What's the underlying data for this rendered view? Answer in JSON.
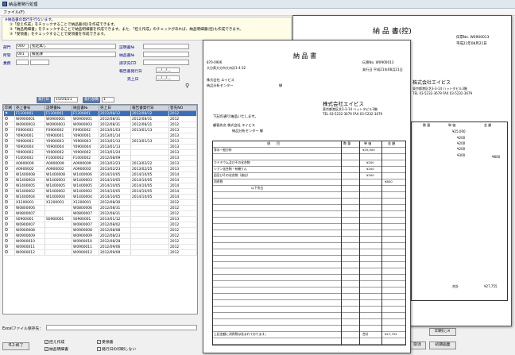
{
  "window": {
    "title": "納品書発行処理",
    "menu": "ファイル(F)"
  },
  "notice": {
    "line1": "※納品書の発行を行ないます。",
    "line2": "①「控え作成」をチェックすることで納品書(控)を作成できます。",
    "line3": "②「納品明細書」をチェックすることで納品明細書を作成できます。また、「控え作成」のチェックがあれば、納品明細書(控)も作成できます。",
    "line4": "③「受領書」をチェックすることで受領書を作成できます。"
  },
  "filters": {
    "bumon_label": "部門",
    "bumon_code": "000",
    "bumon_value": "指定無し",
    "shozoku_label": "所管",
    "shozoku_code": "001",
    "shozoku_value": "検査課",
    "gyosha_label": "業務",
    "seikyu_label": "証明書№",
    "nohin_label": "納品書№",
    "report_label": "報告書発行日",
    "uriage_label": "売上日",
    "client_label": "請求先CD",
    "date_blank": "__/__/__",
    "hakko_label": "発行日",
    "hakko_value": "15/04/21",
    "busu_label": "発行部数",
    "busu_value": "1"
  },
  "table": {
    "headers": [
      "印刷",
      "売上番号",
      "証明書№",
      "納品書№",
      "売上日",
      "報告書発行日",
      "客先NO"
    ],
    "rows": [
      [
        "F1200001",
        "F1200001",
        "F1200001",
        "2012/08/12",
        "2012/08/12",
        "2012"
      ],
      [
        "W0900001",
        "W0900001",
        "W0900001",
        "2012/08/31",
        "2012/08/31",
        "2012"
      ],
      [
        "W0900003",
        "W0900003",
        "W0900003",
        "2012/08/31",
        "2012/08/31",
        "2012"
      ],
      [
        "F0900002",
        "F0900002",
        "F0900002",
        "2013/01/03",
        "2013/01/13",
        "2013"
      ],
      [
        "Y0900001",
        "Y0900001",
        "Y0900001",
        "2013/01/14",
        "",
        "2013"
      ],
      [
        "Y0900003",
        "Y0900003",
        "Y0900003",
        "2013/01/13",
        "2013/01/13",
        "2013"
      ],
      [
        "Y0900004",
        "Y0900004",
        "Y0900004",
        "2013/01/13",
        "",
        "2013"
      ],
      [
        "Y0900002",
        "Y0900002",
        "Y0900002",
        "2013/01/24",
        "",
        "2013"
      ],
      [
        "F1000002",
        "F1000002",
        "F1000002",
        "2012/08/09",
        "",
        "2013"
      ],
      [
        "A0900009",
        "A0900009",
        "A0900009",
        "2013/02/23",
        "2013/02/22",
        "2013"
      ],
      [
        "A0900002",
        "A0900002",
        "A0900002",
        "2013/02/23",
        "2013/02/25",
        "2013"
      ],
      [
        "W1400008",
        "W1400008",
        "W1400006",
        "2014/10/05",
        "2014/10/05",
        "2014"
      ],
      [
        "W1400003",
        "W1400003",
        "W1400003",
        "2014/10/05",
        "2014/10/05",
        "2014"
      ],
      [
        "W1400005",
        "W1400005",
        "W1400005",
        "2014/10/05",
        "2014/10/05",
        "2014"
      ],
      [
        "W1400002",
        "W1400002",
        "W1400002",
        "2014/10/05",
        "2014/10/05",
        "2014"
      ],
      [
        "W1400004",
        "W1400004",
        "W1400004",
        "2014/10/05",
        "2014/10/05",
        "2014"
      ],
      [
        "X1200001",
        "X1200001",
        "X1200001",
        "2012/08/30",
        "",
        "2012"
      ],
      [
        "W0800006",
        "",
        "W0800006",
        "2012/08/31",
        "",
        "2012"
      ],
      [
        "W0800007",
        "",
        "W0800007",
        "2012/08/31",
        "",
        "2012"
      ],
      [
        "S0900001",
        "S0900001",
        "S0900001",
        "2013/01/12",
        "",
        "2013"
      ],
      [
        "W0900007",
        "",
        "W0900007",
        "2012/08/02",
        "",
        "2012"
      ],
      [
        "W0900008",
        "",
        "W0900008",
        "2012/08/08",
        "",
        "2012"
      ],
      [
        "W0900009",
        "",
        "W0900009",
        "2012/08/23",
        "",
        "2012"
      ],
      [
        "W0900010",
        "",
        "W0900010",
        "2012/08/28",
        "",
        "2012"
      ],
      [
        "W0900011",
        "",
        "W0900011",
        "2012/09/06",
        "",
        "2012"
      ],
      [
        "W0900012",
        "",
        "W0900012",
        "2012/09/09",
        "",
        "2012"
      ]
    ]
  },
  "bottom": {
    "excel_label": "Excelファイル保存先：",
    "f12": "f12:終了",
    "ck_hikae": "控え作成",
    "ck_juryo": "受領書",
    "ck_meisai": "納品明細書",
    "ck_noprint": "発行日の印刷しない",
    "btn_torikeshi": "取消",
    "btn_init": "初期画面",
    "btn_print": "印刷(○×"
  },
  "back_sheet": {
    "title": "納 品 書(控)",
    "denpyo": "伝票No.  W0900013",
    "hakko": "平成21年08月21日",
    "company": "株式会社エイビス",
    "addr": "東京都港区芝3-3-14 ハットタビル3階",
    "tel": "TEL 03-5232-3679  FAX 03-5232-3679",
    "h_qty": "数 量",
    "h_unit": "単 価",
    "h_amount": "金 額",
    "v1": "¥25,000",
    "v2": "¥200",
    "v3": "¥200",
    "v4": "¥200",
    "v5": "¥300",
    "v6": "¥800",
    "v7": "¥27,755",
    "total_label": "合計"
  },
  "front_sheet": {
    "zip": "870-0906",
    "address": "大分県大分市大州浜1-4-32",
    "client": "株式会社 エイビス",
    "client2": "納品分析センター",
    "sama": "御",
    "denpyo": "伝票No.  W0900013",
    "hakko": "発行日   平成21年08月21日",
    "title": "納 品 書",
    "company": "株式会社エイビス",
    "addr": "東京都港区芝3-3-14 ハットタビル3階",
    "tel": "TEL 03-5232-3679  FAX 03-5232-3679",
    "lead": "下記の通り納品いたします。",
    "shozoku": "顧客先名  株式会社 エイビス",
    "shozoku2": "納品分析センター 御",
    "h_item": "項　　目",
    "h_qty": "数 量",
    "h_unit": "単 価",
    "h_amount": "金 額",
    "r1": "排水一般分析",
    "r1v": "¥25,000",
    "r2": "カドミウム及びその化合物",
    "r2v": "¥200",
    "r3": "シアン化合物・有機りん",
    "r3v": "¥200",
    "r4": "鉛及びその化合物（溶出）",
    "r4v": "¥200",
    "r5": "消費税",
    "r5v": "¥800",
    "r6": "以下余白",
    "tax": "¥1,275",
    "total": "¥27,755",
    "foot": "上記金額に消費税は含まれております。",
    "goukei": "合計"
  }
}
